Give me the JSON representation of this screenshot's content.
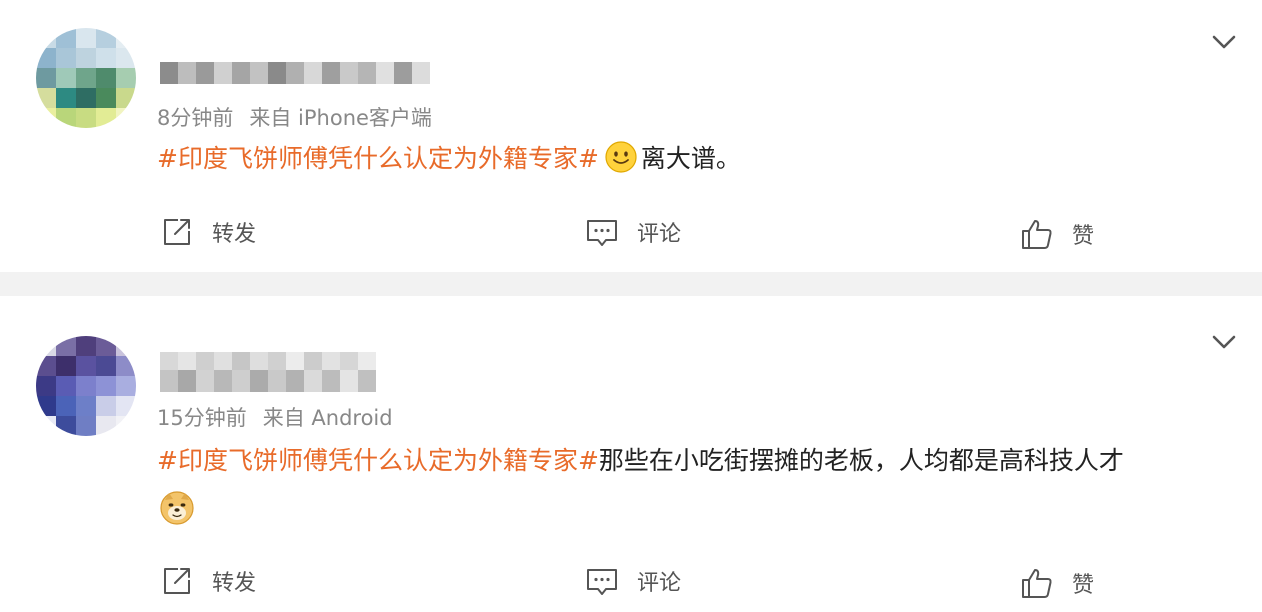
{
  "posts": [
    {
      "meta_time": "8分钟前",
      "meta_source": "来自 iPhone客户端",
      "hashtag": "#印度飞饼师傅凭什么认定为外籍专家#",
      "body_text": "离大谱。",
      "emoji": "smile-emoji",
      "actions": {
        "repost": "转发",
        "comment": "评论",
        "like": "赞"
      }
    },
    {
      "meta_time": "15分钟前",
      "meta_source": "来自 Android",
      "hashtag": "#印度飞饼师傅凭什么认定为外籍专家#",
      "body_text": "那些在小吃街摆摊的老板，人均都是高科技人才",
      "emoji": "doge-emoji",
      "actions": {
        "repost": "转发",
        "comment": "评论",
        "like": "赞"
      }
    }
  ],
  "colors": {
    "hashtag": "#e86b2a",
    "meta": "#888888",
    "separator": "#f2f2f2"
  },
  "icons": [
    "chevron-down-icon",
    "share-icon",
    "comment-icon",
    "thumbs-up-icon"
  ]
}
